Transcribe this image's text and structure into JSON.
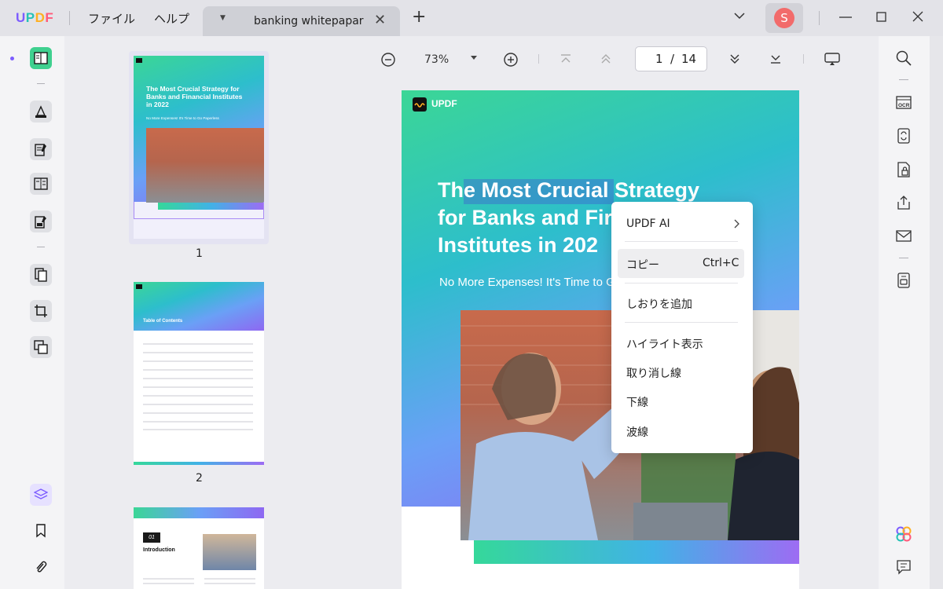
{
  "app": {
    "logo": [
      "U",
      "P",
      "D",
      "F"
    ],
    "menu": [
      "ファイル",
      "ヘルプ"
    ],
    "tab_title": "banking whitepapar",
    "user_initial": "S"
  },
  "toolbar": {
    "zoom": "73%",
    "current_page": "1",
    "page_sep": "/",
    "total_pages": "14"
  },
  "thumbnails": {
    "page_labels": [
      "1",
      "2"
    ],
    "p1_title": "The Most Crucial Strategy for Banks and Financial Institutes in 2022",
    "p1_sub": "No More Expenses! It's Time to Go Paperless",
    "p2_title": "Table of Contents",
    "p3_num": "01",
    "p3_title": "Introduction"
  },
  "document": {
    "logo_text": "UPDF",
    "title_lines": [
      "The Most Crucial Strategy",
      "for Banks and Fir",
      "Institutes in 202"
    ],
    "subtitle": "No More Expenses! It's Time to G"
  },
  "context_menu": {
    "ai_label": "UPDF AI",
    "copy_label": "コピー",
    "copy_shortcut": "Ctrl+C",
    "bookmark_label": "しおりを追加",
    "highlight_label": "ハイライト表示",
    "strike_label": "取り消し線",
    "underline_label": "下線",
    "wavy_label": "波線"
  },
  "colors": {
    "accent_green": "#3fd08f",
    "accent_purple": "#7c5cff",
    "avatar": "#f26b6b"
  }
}
